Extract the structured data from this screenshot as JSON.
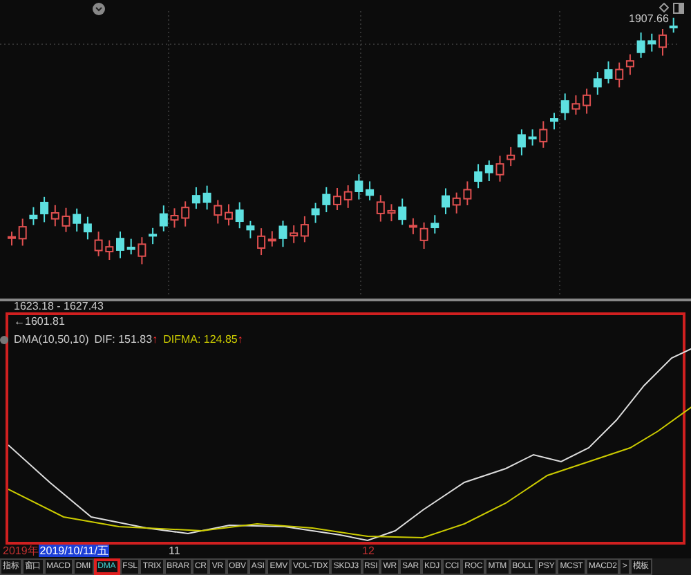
{
  "price_chart": {
    "high_label": "1907.66",
    "range_label": "1623.18 - 1627.43",
    "low_label": "←1601.81"
  },
  "indicator": {
    "name": "DMA(10,50,10)",
    "dif_label": "DIF:",
    "dif_value": "151.83",
    "dif_arrow": "↑",
    "difma_label": "DIFMA:",
    "difma_value": "124.85",
    "difma_arrow": "↑"
  },
  "time_axis": {
    "year": "2019年",
    "cursor_date": "2019/10/11/五",
    "ticks": [
      "11",
      "12"
    ]
  },
  "tabs": [
    {
      "label": "指标",
      "selected": false
    },
    {
      "label": "窗口",
      "selected": false
    },
    {
      "label": "MACD",
      "selected": false
    },
    {
      "label": "DMI",
      "selected": false
    },
    {
      "label": "DMA",
      "selected": true
    },
    {
      "label": "FSL",
      "selected": false
    },
    {
      "label": "TRIX",
      "selected": false
    },
    {
      "label": "BRAR",
      "selected": false
    },
    {
      "label": "CR",
      "selected": false
    },
    {
      "label": "VR",
      "selected": false
    },
    {
      "label": "OBV",
      "selected": false
    },
    {
      "label": "ASI",
      "selected": false
    },
    {
      "label": "EMV",
      "selected": false
    },
    {
      "label": "VOL-TDX",
      "selected": false
    },
    {
      "label": "SKDJ3",
      "selected": false
    },
    {
      "label": "RSI",
      "selected": false
    },
    {
      "label": "WR",
      "selected": false
    },
    {
      "label": "SAR",
      "selected": false
    },
    {
      "label": "KDJ",
      "selected": false
    },
    {
      "label": "CCI",
      "selected": false
    },
    {
      "label": "ROC",
      "selected": false
    },
    {
      "label": "MTM",
      "selected": false
    },
    {
      "label": "BOLL",
      "selected": false
    },
    {
      "label": "PSY",
      "selected": false
    },
    {
      "label": "MCST",
      "selected": false
    },
    {
      "label": "MACD2",
      "selected": false
    }
  ],
  "tab_more": ">",
  "template_button": "模板"
}
